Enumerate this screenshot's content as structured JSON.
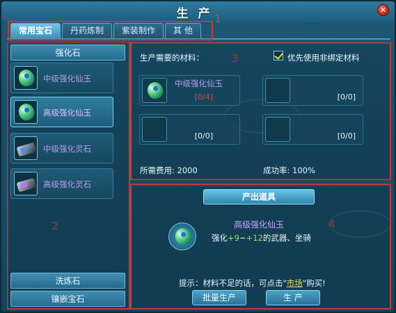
{
  "window": {
    "title": "生产",
    "close_icon": "close-icon"
  },
  "annotations": [
    "1",
    "2",
    "3",
    "4"
  ],
  "tabs": [
    {
      "label": "常用宝石",
      "active": true
    },
    {
      "label": "丹药炼制",
      "active": false
    },
    {
      "label": "紫装制作",
      "active": false
    },
    {
      "label": "其  他",
      "active": false
    }
  ],
  "left_panel": {
    "header": "强化石",
    "items": [
      {
        "label": "中级强化仙玉",
        "icon": "green-gem-icon",
        "selected": false
      },
      {
        "label": "高级强化仙玉",
        "icon": "green-gem-icon",
        "selected": true
      },
      {
        "label": "中级强化灵石",
        "icon": "blue-stone-icon",
        "selected": false
      },
      {
        "label": "高级强化灵石",
        "icon": "purple-stone-icon",
        "selected": false
      }
    ],
    "bottom_buttons": [
      "洗炼石",
      "镶嵌宝石"
    ]
  },
  "materials": {
    "label": "生产需要的材料：",
    "prefer_unbound_label": "优先使用非绑定材料",
    "prefer_unbound_checked": true,
    "slots": [
      {
        "name": "中级强化仙玉",
        "count": "[0/4]",
        "insufficient": true
      },
      {
        "name": "",
        "count": "[0/0]",
        "insufficient": false
      },
      {
        "name": "",
        "count": "[0/0]",
        "insufficient": false
      },
      {
        "name": "",
        "count": "[0/0]",
        "insufficient": false
      }
    ],
    "cost_label": "所需费用: 2000",
    "success_label": "成功率: 100%"
  },
  "output": {
    "header": "产出道具",
    "item_name": "高级强化仙玉",
    "desc_prefix": "强化",
    "desc_range_a": "+9",
    "desc_tilde": "~",
    "desc_range_b": "+12",
    "desc_suffix": "的武器、坐骑",
    "hint_prefix": "提示：材料不足的话，可点击\"",
    "hint_market": "市场",
    "hint_suffix": "\"购买!",
    "batch_button": "批量生产",
    "produce_button": "生  产"
  },
  "colors": {
    "annotation_red": "#c23a34",
    "item_name_purple": "#b79be6",
    "bonus_green": "#9ee256",
    "market_yellow": "#f2dc5a"
  }
}
